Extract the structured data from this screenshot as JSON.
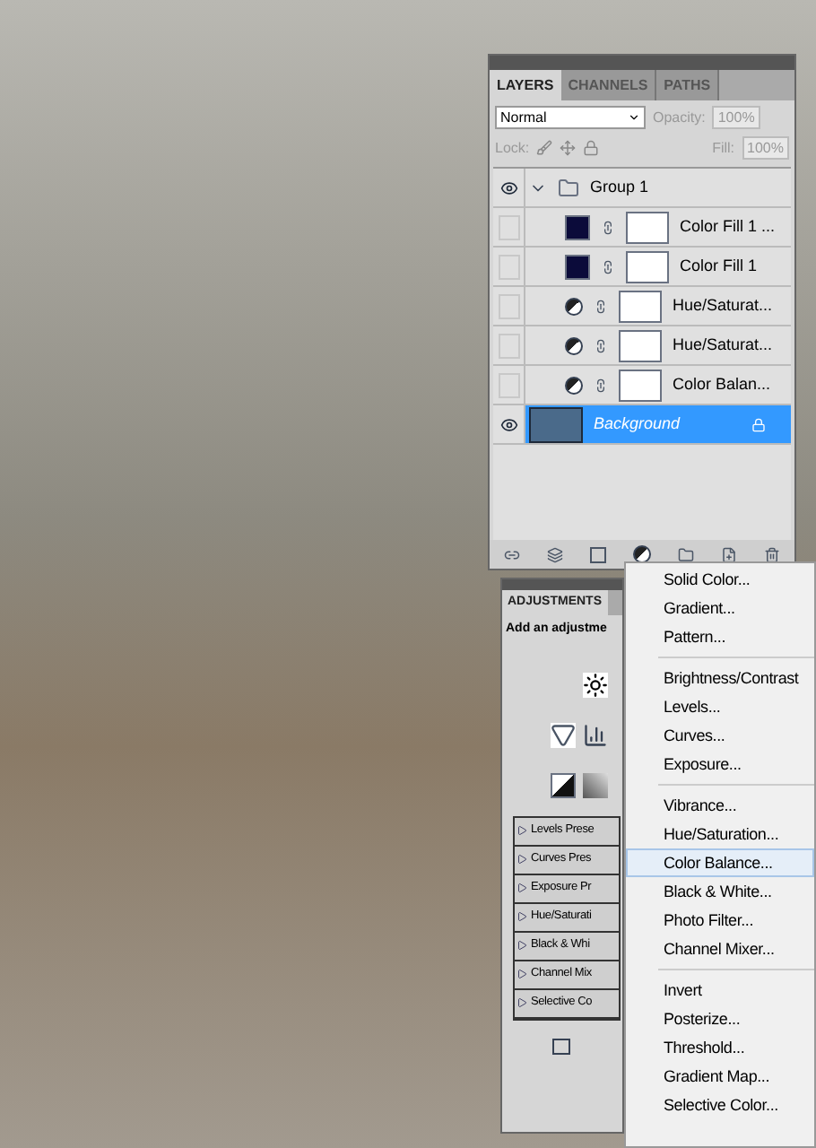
{
  "layers_panel": {
    "tabs": [
      {
        "label": "LAYERS",
        "selected": true
      },
      {
        "label": "CHANNELS",
        "selected": false
      },
      {
        "label": "PATHS",
        "selected": false
      }
    ],
    "blend_mode": "Normal",
    "opacity_label": "Opacity:",
    "opacity": "100%",
    "lock_label": "Lock:",
    "fill_label": "Fill:",
    "fill": "100%",
    "layers": [
      {
        "name": "Group 1",
        "kind": "group",
        "visible": true,
        "selected": false,
        "expanded": true,
        "children": [
          {
            "name": "Color Fill 1 ...",
            "kind": "fill",
            "visible": false,
            "selected": false
          },
          {
            "name": "Color Fill 1",
            "kind": "fill",
            "visible": false,
            "selected": false
          },
          {
            "name": "Hue/Saturat...",
            "kind": "adjustment",
            "visible": false,
            "selected": false
          },
          {
            "name": "Hue/Saturat...",
            "kind": "adjustment",
            "visible": false,
            "selected": false
          },
          {
            "name": "Color Balan...",
            "kind": "adjustment",
            "visible": false,
            "selected": false
          }
        ]
      },
      {
        "name": "Background",
        "kind": "image",
        "visible": true,
        "selected": true
      }
    ]
  },
  "adjustments_panel": {
    "tab": "ADJUSTMENTS",
    "subtitle": "Add an adjustme",
    "presets": [
      {
        "label": "Levels Prese"
      },
      {
        "label": "Curves Pres"
      },
      {
        "label": "Exposure Pr"
      },
      {
        "label": "Hue/Saturati"
      },
      {
        "label": "Black & Whi"
      },
      {
        "label": "Channel Mix"
      },
      {
        "label": "Selective Co"
      }
    ]
  },
  "menu": {
    "groups": [
      [
        {
          "label": "Solid Color...",
          "selected": false
        },
        {
          "label": "Gradient...",
          "selected": false
        },
        {
          "label": "Pattern...",
          "selected": false
        }
      ],
      [
        {
          "label": "Brightness/Contrast",
          "selected": false
        },
        {
          "label": "Levels...",
          "selected": false
        },
        {
          "label": "Curves...",
          "selected": false
        },
        {
          "label": "Exposure...",
          "selected": false
        }
      ],
      [
        {
          "label": "Vibrance...",
          "selected": false
        },
        {
          "label": "Hue/Saturation...",
          "selected": false
        },
        {
          "label": "Color Balance...",
          "selected": true
        },
        {
          "label": "Black & White...",
          "selected": false
        },
        {
          "label": "Photo Filter...",
          "selected": false
        },
        {
          "label": "Channel Mixer...",
          "selected": false
        }
      ],
      [
        {
          "label": "Invert",
          "selected": false
        },
        {
          "label": "Posterize...",
          "selected": false
        },
        {
          "label": "Threshold...",
          "selected": false
        },
        {
          "label": "Gradient Map...",
          "selected": false
        },
        {
          "label": "Selective Color...",
          "selected": false
        }
      ]
    ]
  }
}
